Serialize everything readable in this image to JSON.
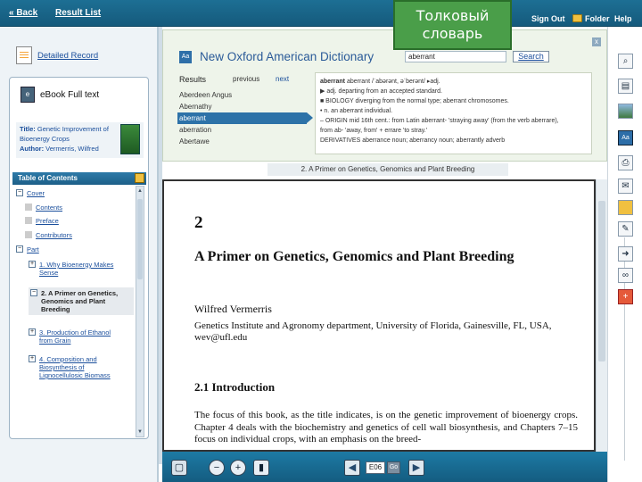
{
  "topbar": {
    "back": "« Back",
    "result_list": "Result List",
    "sign_out": "Sign Out",
    "folder": "Folder",
    "help": "Help"
  },
  "callout": {
    "line1": "Толковый",
    "line2": "словарь"
  },
  "left": {
    "detailed_record": "Detailed Record",
    "ebook_label": "eBook Full text",
    "book_title_label": "Title:",
    "book_title": "Genetic Improvement of Bioenergy Crops",
    "book_author_label": "Author:",
    "book_author": "Vermerris, Wilfred",
    "toc_header": "Table of Contents",
    "toc": [
      {
        "label": "Cover",
        "marker": "−",
        "link": true
      },
      {
        "label": "Contents",
        "marker": "",
        "link": true
      },
      {
        "label": "Preface",
        "marker": "",
        "link": true
      },
      {
        "label": "Contributors",
        "marker": "",
        "link": true
      },
      {
        "label": "Part",
        "marker": "−",
        "link": true
      },
      {
        "label": "1. Why Bioenergy Makes Sense",
        "marker": "+",
        "link": true
      },
      {
        "label": "2. A Primer on Genetics, Genomics and Plant Breeding",
        "marker": "−",
        "link": false
      },
      {
        "label": "3. Production of Ethanol from Grain",
        "marker": "+",
        "link": true
      },
      {
        "label": "4. Composition and Biosynthesis of Lignocellulosic Biomass",
        "marker": "+",
        "link": true
      }
    ]
  },
  "dictionary": {
    "logo": "Aa",
    "title": "New Oxford American Dictionary",
    "search_value": "aberrant",
    "search_button": "Search",
    "close": "x",
    "results_label": "Results",
    "previous": "previous",
    "next": "next",
    "words": [
      "Aberdeen Angus",
      "Abernathy",
      "aberrant",
      "aberration",
      "Abertawe"
    ],
    "headword": "aberrant",
    "pronunciation": "aberrant /ˈabərənt, əˈberənt/ ▸adj.",
    "definitions": [
      "▶ adj. departing from an accepted standard.",
      "■ BIOLOGY diverging from the normal type; aberrant chromosomes.",
      "• n. an aberrant individual.",
      "– ORIGIN mid 16th cent.: from Latin aberrant- 'straying away' (from the verb aberrare),",
      "  from ab- 'away, from' + errare 'to stray.'",
      "DERIVATIVES aberrance noun; aberrancy noun; aberrantly adverb"
    ]
  },
  "page": {
    "tab_label": "2. A Primer on Genetics, Genomics and Plant Breeding",
    "chapter_number": "2",
    "chapter_title": "A Primer on Genetics, Genomics and Plant Breeding",
    "author": "Wilfred Vermerris",
    "affiliation": "Genetics Institute and Agronomy department, University of Florida, Gainesville, FL, USA, wev@ufl.edu",
    "section": "2.1 Introduction",
    "body": "The focus of this book, as the title indicates, is on the genetic improvement of bioenergy crops. Chapter 4 deals with the biochemistry and genetics of cell wall biosynthesis, and Chapters 7–15 focus on individual crops, with an emphasis on the breed-"
  },
  "bottombar": {
    "page_number": "E06",
    "go": "Go"
  },
  "right_tools": [
    "search-icon",
    "bookmark-icon",
    "image-icon",
    "dictionary-icon",
    "print-icon",
    "email-icon",
    "save-icon",
    "notes-icon",
    "export-icon",
    "link-icon",
    "add-icon"
  ]
}
